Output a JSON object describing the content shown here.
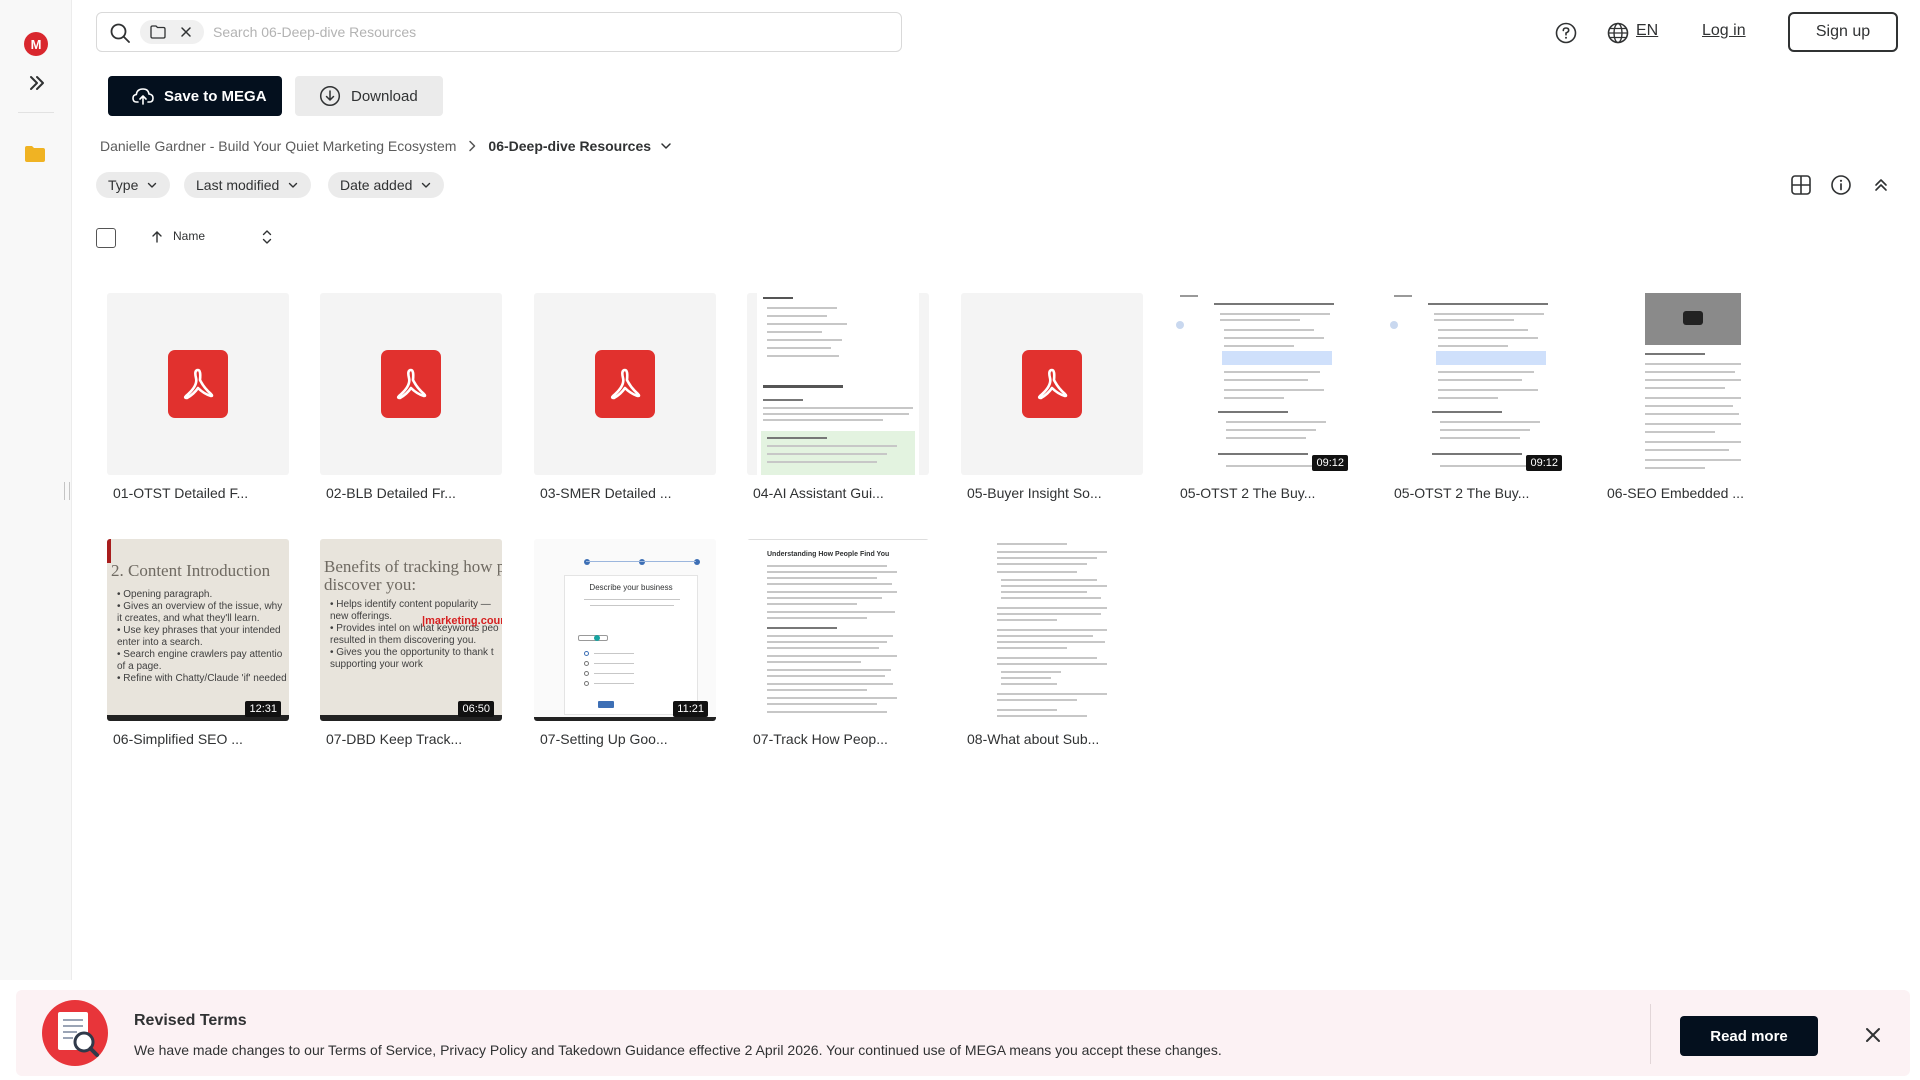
{
  "sidebar": {
    "logo_letter": "M"
  },
  "search": {
    "placeholder": "Search 06-Deep-dive Resources"
  },
  "header": {
    "language": "EN",
    "login_label": "Log in",
    "signup_label": "Sign up"
  },
  "actions": {
    "save_label": "Save to MEGA",
    "download_label": "Download"
  },
  "breadcrumb": {
    "parent": "Danielle Gardner - Build Your Quiet Marketing Ecosystem",
    "current": "06-Deep-dive Resources"
  },
  "filters": {
    "type": "Type",
    "last_modified": "Last modified",
    "date_added": "Date added"
  },
  "list_header": {
    "name": "Name"
  },
  "files": [
    {
      "name": "01-OTST Detailed F...",
      "kind": "pdf"
    },
    {
      "name": "02-BLB Detailed Fr...",
      "kind": "pdf"
    },
    {
      "name": "03-SMER Detailed ...",
      "kind": "pdf"
    },
    {
      "name": "04-AI Assistant Gui...",
      "kind": "document"
    },
    {
      "name": "05-Buyer Insight So...",
      "kind": "pdf"
    },
    {
      "name": "05-OTST 2 The Buy...",
      "kind": "video",
      "duration": "09:12"
    },
    {
      "name": "05-OTST 2 The Buy...",
      "kind": "video",
      "duration": "09:12"
    },
    {
      "name": "06-SEO Embedded ...",
      "kind": "document"
    },
    {
      "name": "06-Simplified SEO ...",
      "kind": "video",
      "duration": "12:31",
      "slide_title": "2. Content Introduction",
      "slide_lines": [
        "• Opening paragraph.",
        "• Gives an overview of the issue, why",
        "  it creates, and what they'll learn.",
        "• Use key phrases that your intended",
        "  enter into a search.",
        "• Search engine crawlers pay attentio",
        "  of a page.",
        "• Refine with Chatty/Claude 'if' needed"
      ]
    },
    {
      "name": "07-DBD Keep Track...",
      "kind": "video",
      "duration": "06:50",
      "slide_title": "Benefits of tracking how peo",
      "slide_title_2": "discover you:",
      "slide_lines": [
        "• Helps identify content popularity —",
        "  new offerings.",
        "• Provides intel on what keywords peo",
        "  resulted in them discovering you.",
        "• Gives you the opportunity to thank t",
        "  supporting your work"
      ],
      "watermark": "|marketing.cours"
    },
    {
      "name": "07-Setting Up Goo...",
      "kind": "video",
      "duration": "11:21",
      "screen_heading": "Describe your business"
    },
    {
      "name": "07-Track How Peop...",
      "kind": "document",
      "doc_heading": "Understanding How People Find You"
    },
    {
      "name": "08-What about Sub...",
      "kind": "document"
    }
  ],
  "banner": {
    "title": "Revised Terms",
    "text": "We have made changes to our Terms of Service, Privacy Policy and Takedown Guidance effective 2 April 2026. Your continued use of MEGA means you accept these changes.",
    "read_more": "Read more"
  }
}
